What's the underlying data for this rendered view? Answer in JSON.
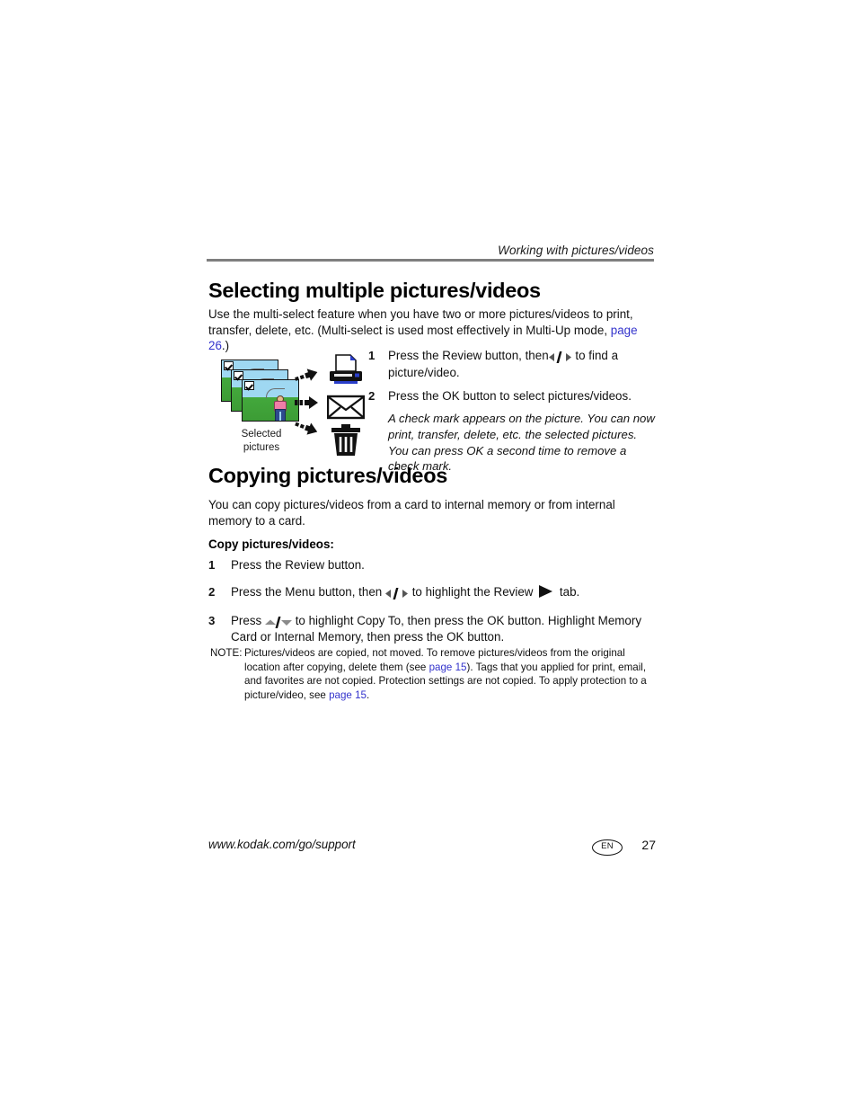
{
  "header": {
    "running_title": "Working with pictures/videos"
  },
  "sections": {
    "selecting": {
      "title": "Selecting multiple pictures/videos",
      "intro_part1": "Use the multi-select feature when you have two or more pictures/videos to print, transfer, delete, etc. (Multi-select is used most effectively in Multi-Up mode, ",
      "intro_link": "page 26",
      "intro_part2": ".)",
      "steps": [
        {
          "num": "1",
          "text_before": "Press the Review button, then",
          "glyph": "left-right-arrows",
          "text_after": "to find a picture/video."
        },
        {
          "num": "2",
          "text_before": "Press the OK button to select pictures/videos.",
          "glyph": "",
          "text_after": ""
        }
      ],
      "step_note": "A check mark appears on the picture. You can now print, transfer, delete, etc. the selected pictures. You can press OK a second time to remove a check mark."
    },
    "copying": {
      "title": "Copying pictures/videos",
      "intro": "You can copy pictures/videos from a card to internal memory or from internal memory to a card.",
      "lead": "Copy pictures/videos:",
      "steps": [
        {
          "num": "1",
          "part1": "Press the Review button.",
          "part2": "",
          "part3": ""
        },
        {
          "num": "2",
          "part1": "Press the Menu button, then",
          "part2": "to highlight the Review",
          "part3": "tab."
        },
        {
          "num": "3",
          "part1": "Press",
          "part2": "to highlight Copy To, then press the OK button. Highlight Memory Card or Internal Memory, then press the OK button.",
          "part3": ""
        }
      ]
    }
  },
  "illustration": {
    "caption": "Selected pictures",
    "photo_count": 3,
    "check_mark": "✓",
    "icons": [
      {
        "name": "printer-icon",
        "label": "print"
      },
      {
        "name": "envelope-icon",
        "label": "email"
      },
      {
        "name": "trash-icon",
        "label": "delete"
      }
    ],
    "arrow_count": 3
  },
  "note": {
    "label": "NOTE:",
    "text_part1": "Pictures/videos are copied, not moved. To remove pictures/videos from the original location after copying, delete them (see ",
    "link1": "page 15",
    "text_part2": "). Tags that you applied for print, email, and favorites are not copied. Protection settings are not copied. To apply protection to a picture/video, see ",
    "link2": "page 15",
    "text_part3": "."
  },
  "footer": {
    "url": "www.kodak.com/go/support",
    "language": "EN",
    "page_number": "27"
  },
  "colors": {
    "link": "#3333cc",
    "rule": "#7f7f7f",
    "text": "#111111",
    "photo_sky": "#9fd8f2",
    "photo_grass": "#43a83c"
  }
}
